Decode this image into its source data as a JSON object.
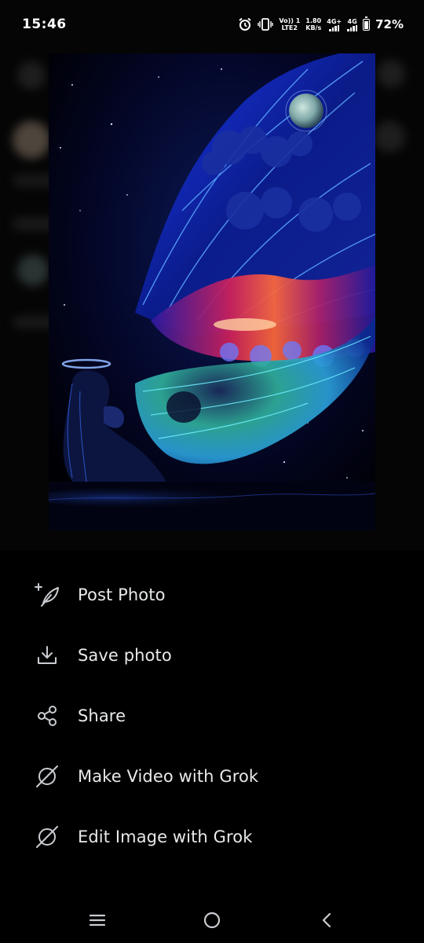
{
  "status_bar": {
    "time": "15:46",
    "volte_top": "Vo)) 1",
    "volte_bottom": "LTE2",
    "speed_top": "1.80",
    "speed_bottom": "KB/s",
    "network1": "4G+",
    "network2": "4G",
    "battery": "72%"
  },
  "image": {
    "subject": "winged-angel-with-halo-under-starry-sky"
  },
  "menu": {
    "items": [
      {
        "label": "Post Photo",
        "icon": "feather-plus-icon"
      },
      {
        "label": "Save photo",
        "icon": "download-icon"
      },
      {
        "label": "Share",
        "icon": "share-icon"
      },
      {
        "label": "Make Video with Grok",
        "icon": "grok-icon"
      },
      {
        "label": "Edit Image with Grok",
        "icon": "grok-icon"
      }
    ]
  },
  "nav": {
    "recents": "recents-icon",
    "home": "home-icon",
    "back": "back-icon"
  },
  "colors": {
    "background": "#000000",
    "text": "#e7e9ea",
    "icon": "#c9ccd0"
  }
}
